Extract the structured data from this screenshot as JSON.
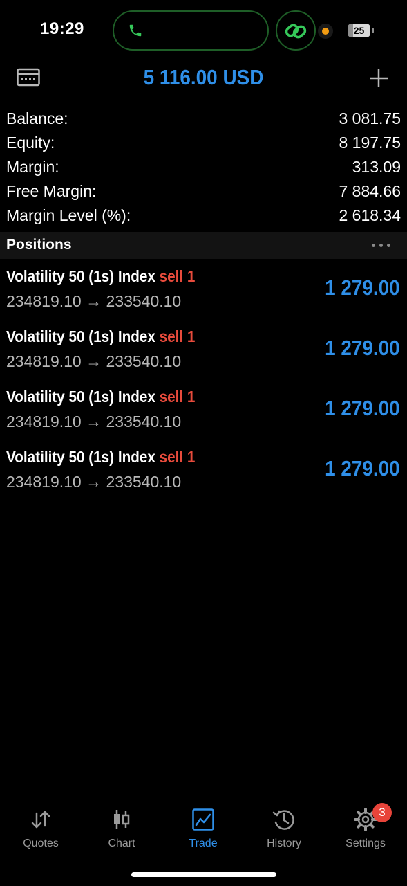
{
  "status_bar": {
    "time": "19:29",
    "battery": "25",
    "battery_level": 0.25,
    "icons": [
      "phone-icon",
      "link-icon",
      "mic-indicator-icon",
      "battery-icon"
    ]
  },
  "header": {
    "title": "5 116.00 USD",
    "left_icon": "account-card-icon",
    "right_icon": "plus-icon"
  },
  "summary": [
    {
      "label": "Balance:",
      "value": "3 081.75"
    },
    {
      "label": "Equity:",
      "value": "8 197.75"
    },
    {
      "label": "Margin:",
      "value": "313.09"
    },
    {
      "label": "Free Margin:",
      "value": "7 884.66"
    },
    {
      "label": "Margin Level (%):",
      "value": "2 618.34"
    }
  ],
  "positions": {
    "title": "Positions",
    "items": [
      {
        "symbol": "Volatility 50 (1s) Index",
        "side": "sell 1",
        "prices": "234819.10 → 233540.10",
        "profit": "1 279.00"
      },
      {
        "symbol": "Volatility 50 (1s) Index",
        "side": "sell 1",
        "prices": "234819.10 → 233540.10",
        "profit": "1 279.00"
      },
      {
        "symbol": "Volatility 50 (1s) Index",
        "side": "sell 1",
        "prices": "234819.10 → 233540.10",
        "profit": "1 279.00"
      },
      {
        "symbol": "Volatility 50 (1s) Index",
        "side": "sell 1",
        "prices": "234819.10 → 233540.10",
        "profit": "1 279.00"
      }
    ]
  },
  "tabs": [
    {
      "label": "Quotes",
      "icon": "quotes-arrows-icon"
    },
    {
      "label": "Chart",
      "icon": "candlestick-icon"
    },
    {
      "label": "Trade",
      "icon": "trade-chart-icon",
      "active": true
    },
    {
      "label": "History",
      "icon": "history-clock-icon"
    },
    {
      "label": "Settings",
      "icon": "gear-icon",
      "badge": "3"
    }
  ],
  "colors": {
    "accent": "#2f8fe8",
    "sell": "#e84b3c",
    "call_green": "#35c759",
    "badge": "#e8443a"
  }
}
